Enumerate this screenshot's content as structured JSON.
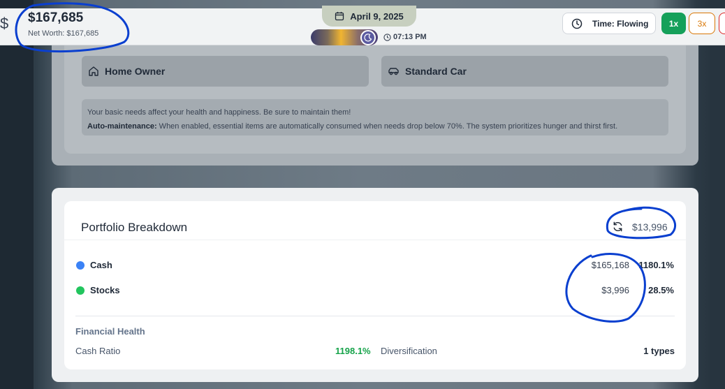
{
  "colors": {
    "accent_green": "#15a05a",
    "warning_orange": "#d97706",
    "cash_dot": "#3b82f6",
    "stocks_dot": "#22c55e",
    "positive_green": "#16a34a",
    "annotation_blue": "#0a3fcf"
  },
  "header": {
    "currency_symbol": "$",
    "net_worth_value": "$167,685",
    "net_worth_label": "Net Worth: $167,685",
    "date": "April 9, 2025",
    "time": "07:13 PM",
    "time_mode_label": "Time: Flowing",
    "speed_1x": "1x",
    "speed_3x": "3x",
    "icons": [
      "dollar-icon",
      "calendar-icon",
      "moon-icon",
      "clock-icon"
    ]
  },
  "assets": {
    "home_label": "Home Owner",
    "car_label": "Standard Car"
  },
  "needs": {
    "line1": "Your basic needs affect your health and happiness. Be sure to maintain them!",
    "auto_label": "Auto-maintenance:",
    "auto_text": " When enabled, essential items are automatically consumed when needs drop below 70%. The system prioritizes hunger and thirst first."
  },
  "portfolio": {
    "title": "Portfolio Breakdown",
    "total": "$13,996",
    "rows": [
      {
        "name": "Cash",
        "value": "$165,168",
        "percent": "1180.1%"
      },
      {
        "name": "Stocks",
        "value": "$3,996",
        "percent": "28.5%"
      }
    ],
    "financial_health_title": "Financial Health",
    "cash_ratio_label": "Cash Ratio",
    "cash_ratio_value": "1198.1%",
    "diversification_label": "Diversification",
    "diversification_value": "1 types"
  }
}
